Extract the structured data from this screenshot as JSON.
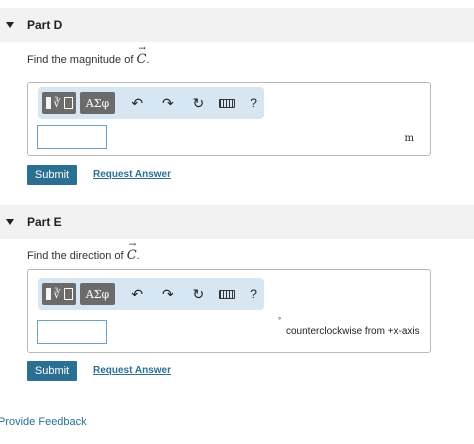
{
  "parts": [
    {
      "title": "Part D",
      "prompt": "Find the magnitude of",
      "vector": "C",
      "unit": "m",
      "submit_label": "Submit",
      "request_label": "Request Answer"
    },
    {
      "title": "Part E",
      "prompt": "Find the direction of",
      "vector": "C",
      "unit": "counterclockwise from +x-axis",
      "degree_symbol": "°",
      "submit_label": "Submit",
      "request_label": "Request Answer"
    }
  ],
  "toolbar": {
    "greek_label": "ΑΣφ",
    "undo_glyph": "↶",
    "redo_glyph": "↷",
    "reset_glyph": "↻",
    "help_label": "?"
  },
  "footer": {
    "feedback_label": "Provide Feedback"
  },
  "colors": {
    "accent": "#2b6f93",
    "toolbar_bg": "#d6e6f2",
    "header_bg": "#f2f2f2"
  }
}
